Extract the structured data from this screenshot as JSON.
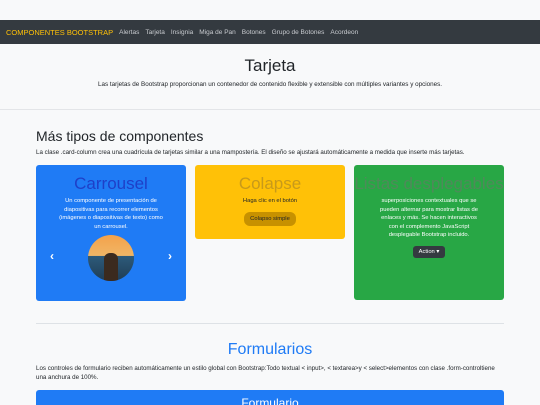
{
  "navbar": {
    "brand": "COMPONENTES BOOTSTRAP",
    "links": [
      "Alertas",
      "Tarjeta",
      "Insignia",
      "Miga de Pan",
      "Botones",
      "Grupo de Botones",
      "Acordeon"
    ]
  },
  "hero": {
    "title": "Tarjeta",
    "subtitle": "Las tarjetas de Bootstrap proporcionan un contenedor de contenido flexible y extensible con múltiples variantes y opciones."
  },
  "section": {
    "title": "Más tipos de componentes",
    "description": "La clase .card-column crea una cuadrícula de tarjetas similar a una mampostería. El diseño se ajustará automáticamente a medida que inserte más tarjetas."
  },
  "cards": {
    "carousel": {
      "title": "Carrousel",
      "text": "Un componente de presentación de diapositivas para recorrer elementos (imágenes o diapositivas de texto) como un carrousel.",
      "prev": "‹",
      "next": "›"
    },
    "collapse": {
      "title": "Colapse",
      "text": "Haga clic en el botón",
      "button": "Colapso simple"
    },
    "dropdown": {
      "title": "Listas desplegables",
      "text": "superposiciones contextuales que se pueden alternar para mostrar listas de enlaces y más. Se hacen interactivos con el complemento JavaScript desplegable Bootstrap incluido.",
      "button": "Action ▾"
    }
  },
  "forms": {
    "title": "Formularios",
    "description": "Los controles de formulario reciben automáticamente un estilo global con Bootstrap:Todo textual < input>, < textarea>y < select>elementos con clase .form-controltiene una anchura de 100%.",
    "card_title": "Formulario"
  },
  "colors": {
    "primary": "#1f7bf5",
    "warning": "#ffc107",
    "success": "#28a745",
    "dark": "#343a40"
  }
}
